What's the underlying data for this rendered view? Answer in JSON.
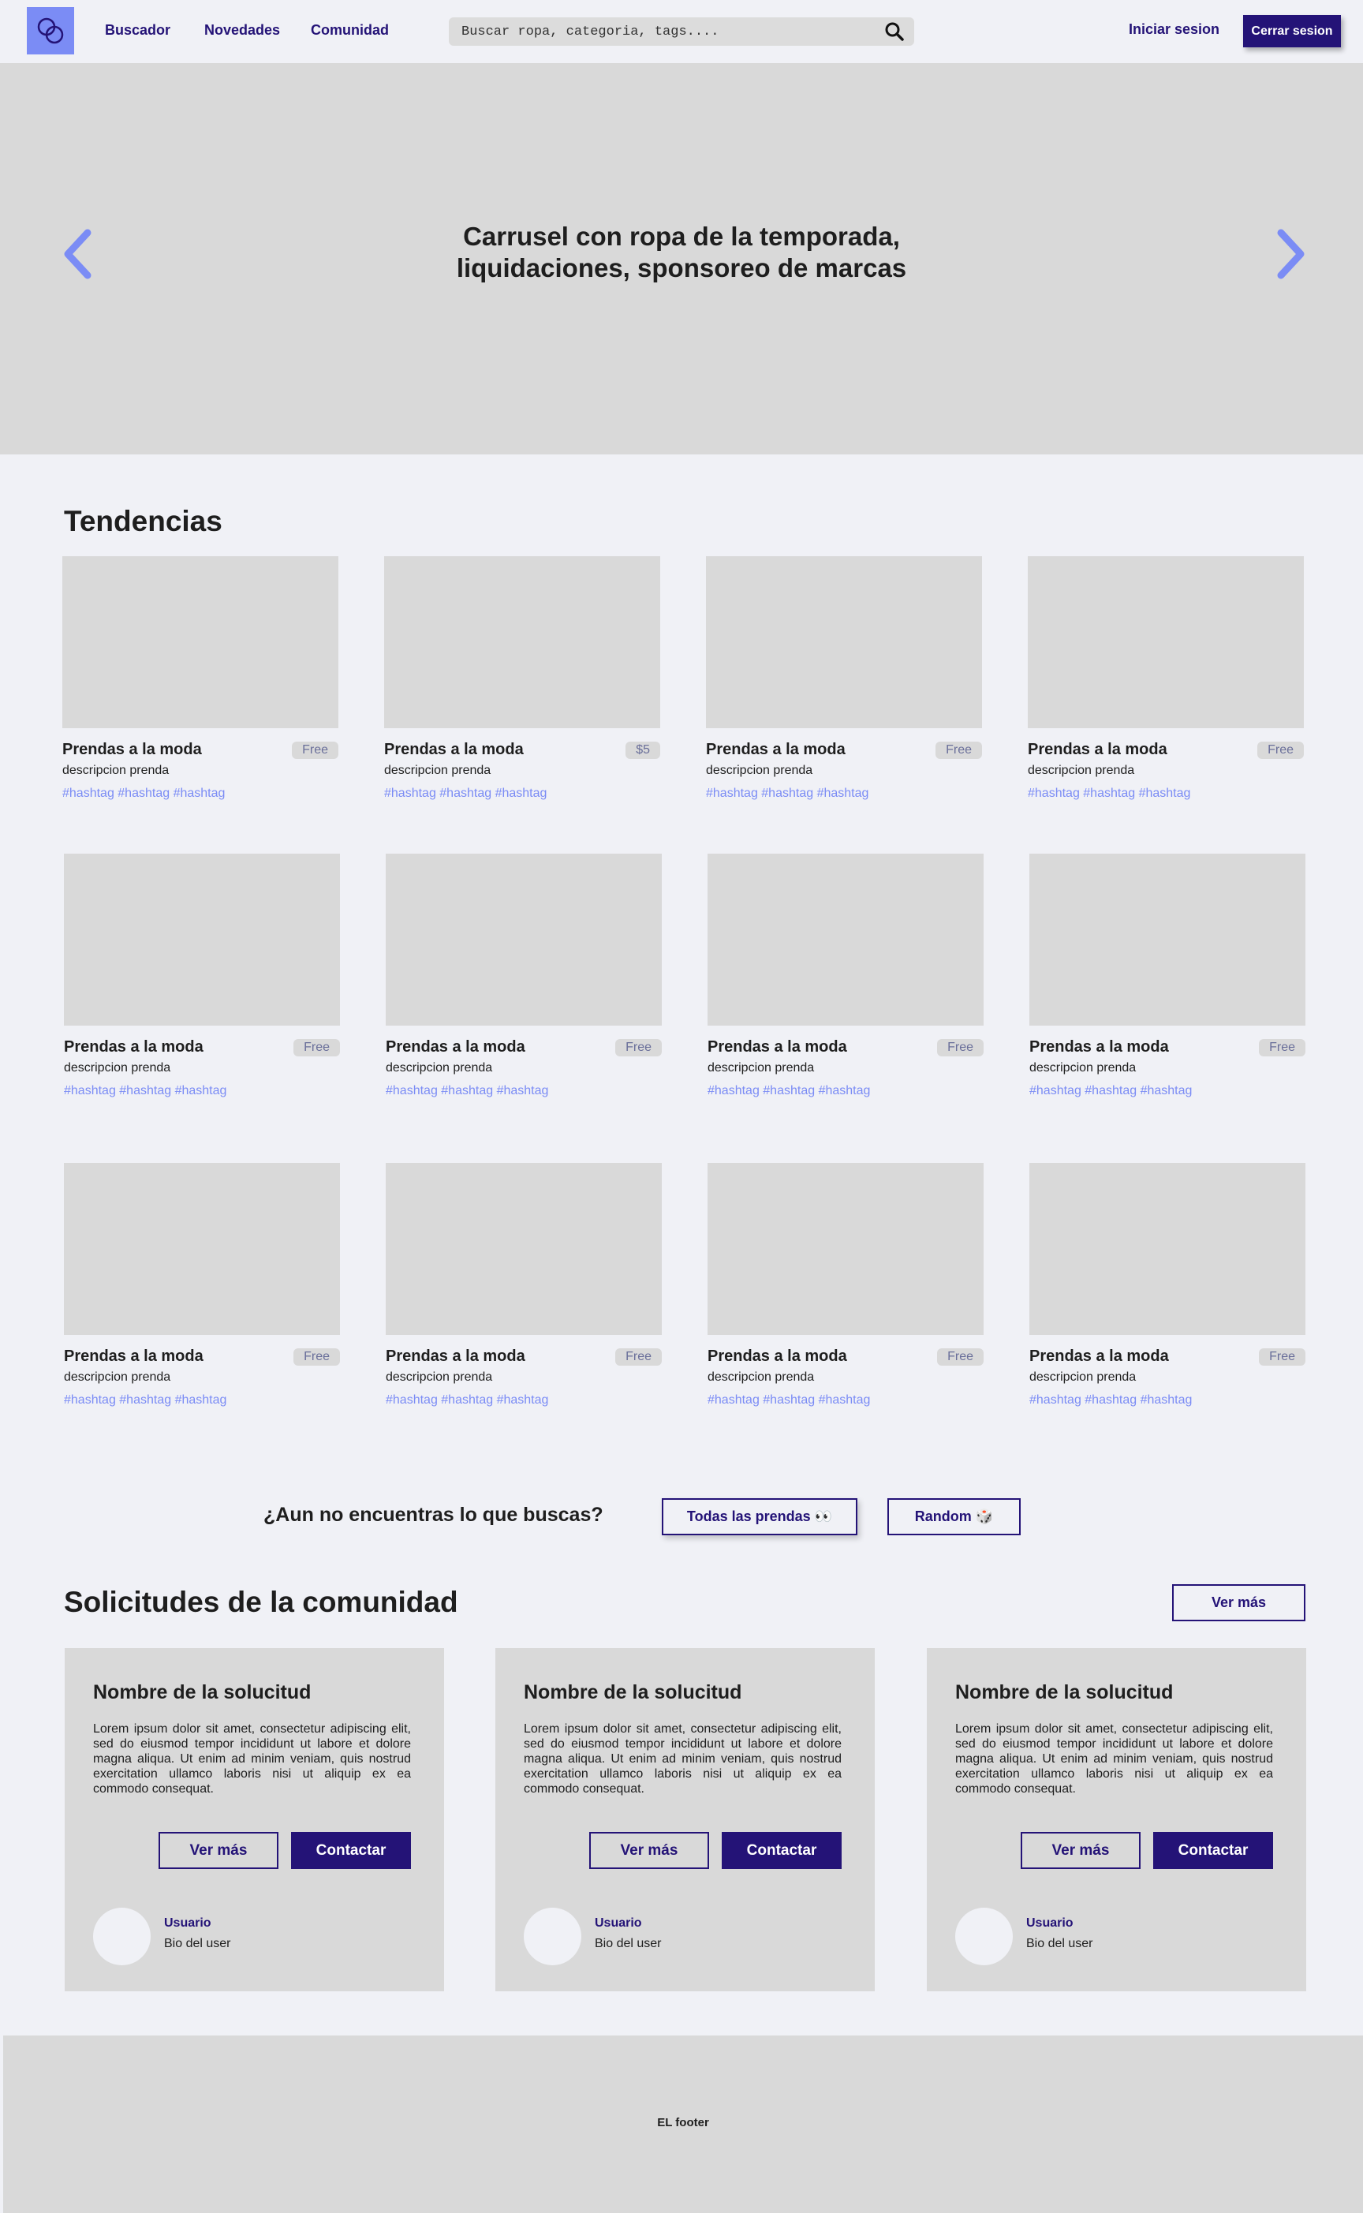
{
  "nav": {
    "links": [
      "Buscador",
      "Novedades",
      "Comunidad"
    ],
    "search_placeholder": "Buscar ropa, categoria, tags....",
    "login_label": "Iniciar sesion",
    "logout_label": "Cerrar sesion"
  },
  "hero": {
    "line1": "Carrusel con ropa de la temporada,",
    "line2": "liquidaciones, sponsoreo de marcas"
  },
  "trends": {
    "title": "Tendencias",
    "items": [
      {
        "title": "Prendas a la moda",
        "badge": "Free",
        "desc": "descripcion prenda",
        "tags": "#hashtag #hashtag #hashtag"
      },
      {
        "title": "Prendas a la moda",
        "badge": "$5",
        "desc": "descripcion prenda",
        "tags": "#hashtag #hashtag #hashtag"
      },
      {
        "title": "Prendas a la moda",
        "badge": "Free",
        "desc": "descripcion prenda",
        "tags": "#hashtag #hashtag #hashtag"
      },
      {
        "title": "Prendas a la moda",
        "badge": "Free",
        "desc": "descripcion prenda",
        "tags": "#hashtag #hashtag #hashtag"
      },
      {
        "title": "Prendas a la moda",
        "badge": "Free",
        "desc": "descripcion prenda",
        "tags": "#hashtag #hashtag #hashtag"
      },
      {
        "title": "Prendas a la moda",
        "badge": "Free",
        "desc": "descripcion prenda",
        "tags": "#hashtag #hashtag #hashtag"
      },
      {
        "title": "Prendas a la moda",
        "badge": "Free",
        "desc": "descripcion prenda",
        "tags": "#hashtag #hashtag #hashtag"
      },
      {
        "title": "Prendas a la moda",
        "badge": "Free",
        "desc": "descripcion prenda",
        "tags": "#hashtag #hashtag #hashtag"
      },
      {
        "title": "Prendas a la moda",
        "badge": "Free",
        "desc": "descripcion prenda",
        "tags": "#hashtag #hashtag #hashtag"
      },
      {
        "title": "Prendas a la moda",
        "badge": "Free",
        "desc": "descripcion prenda",
        "tags": "#hashtag #hashtag #hashtag"
      },
      {
        "title": "Prendas a la moda",
        "badge": "Free",
        "desc": "descripcion prenda",
        "tags": "#hashtag #hashtag #hashtag"
      },
      {
        "title": "Prendas a la moda",
        "badge": "Free",
        "desc": "descripcion prenda",
        "tags": "#hashtag #hashtag #hashtag"
      }
    ]
  },
  "cta": {
    "text": "¿Aun no encuentras lo que buscas?",
    "all_label": "Todas las prendas 👀",
    "random_label": "Random 🎲"
  },
  "community": {
    "title": "Solicitudes de la comunidad",
    "see_more": "Ver más",
    "requests": [
      {
        "title": "Nombre de la solucitud",
        "body": "Lorem ipsum dolor sit amet, consectetur adipiscing elit, sed do eiusmod tempor incididunt ut labore et dolore magna aliqua. Ut enim ad minim veniam, quis nostrud exercitation ullamco laboris nisi ut aliquip ex ea commodo consequat.",
        "more": "Ver más",
        "contact": "Contactar",
        "user": "Usuario",
        "bio": "Bio del user"
      },
      {
        "title": "Nombre de la solucitud",
        "body": "Lorem ipsum dolor sit amet, consectetur adipiscing elit, sed do eiusmod tempor incididunt ut labore et dolore magna aliqua. Ut enim ad minim veniam, quis nostrud exercitation ullamco laboris nisi ut aliquip ex ea commodo consequat.",
        "more": "Ver más",
        "contact": "Contactar",
        "user": "Usuario",
        "bio": "Bio del user"
      },
      {
        "title": "Nombre de la solucitud",
        "body": "Lorem ipsum dolor sit amet, consectetur adipiscing elit, sed do eiusmod tempor incididunt ut labore et dolore magna aliqua. Ut enim ad minim veniam, quis nostrud exercitation ullamco laboris nisi ut aliquip ex ea commodo consequat.",
        "more": "Ver más",
        "contact": "Contactar",
        "user": "Usuario",
        "bio": "Bio del user"
      }
    ]
  },
  "footer": {
    "text": "EL footer"
  },
  "colors": {
    "primary": "#241377",
    "accent": "#7B8CF5",
    "background": "#F0F1F6",
    "placeholder": "#D9D9D9"
  },
  "icons": {
    "logo": "interlocked-rings-icon",
    "search": "search-icon",
    "prev": "chevron-left-icon",
    "next": "chevron-right-icon"
  }
}
